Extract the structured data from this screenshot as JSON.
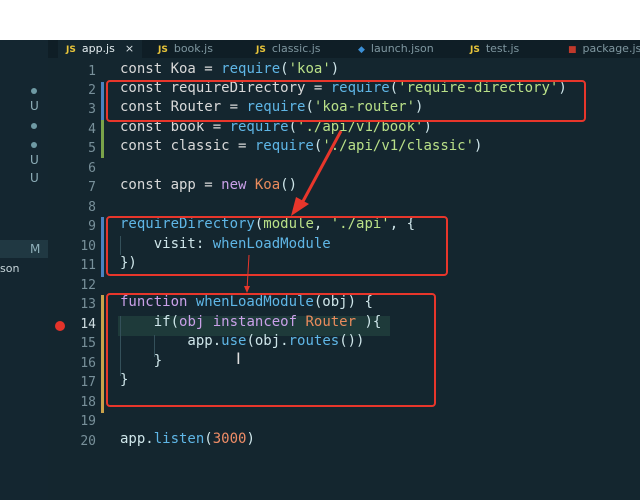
{
  "tabs": [
    {
      "icon": "JS",
      "label": "app.js",
      "active": true,
      "close": "×"
    },
    {
      "icon": "JS",
      "label": "book.js"
    },
    {
      "icon": "JS",
      "label": "classic.js"
    },
    {
      "icon": "vscode-icon",
      "label": "launch.json"
    },
    {
      "icon": "JS",
      "label": "test.js"
    },
    {
      "icon": "package-icon",
      "label": "package.js"
    }
  ],
  "sidebar": {
    "marks": [
      "U",
      "U",
      "U",
      "U",
      "M"
    ],
    "partial_item": "son"
  },
  "line_numbers": [
    "1",
    "2",
    "3",
    "4",
    "5",
    "6",
    "7",
    "8",
    "9",
    "10",
    "11",
    "12",
    "13",
    "14",
    "15",
    "16",
    "17",
    "18",
    "19",
    "20"
  ],
  "code": {
    "l1": {
      "a": "const Koa = ",
      "b": "require",
      "c": "(",
      "d": "'koa'",
      "e": ")"
    },
    "l2": {
      "a": "const requireDirectory = ",
      "b": "require",
      "c": "(",
      "d": "'require-directory'",
      "e": ")"
    },
    "l3": {
      "a": "const Router = ",
      "b": "require",
      "c": "(",
      "d": "'koa-router'",
      "e": ")"
    },
    "l4": {
      "a": "const book = ",
      "b": "require",
      "c": "(",
      "d": "'./api/v1/book'",
      "e": ")"
    },
    "l5": {
      "a": "const classic = ",
      "b": "require",
      "c": "(",
      "d": "'./api/v1/classic'",
      "e": ")"
    },
    "l7": {
      "a": "const app = ",
      "b": "new ",
      "c": "Koa",
      "d": "()"
    },
    "l9": {
      "a": "requireDirectory",
      "b": "(",
      "c": "module",
      "d": ", ",
      "e": "'./api'",
      "f": ", {"
    },
    "l10": {
      "a": "    visit: ",
      "b": "whenLoadModule"
    },
    "l11": {
      "a": "})"
    },
    "l13": {
      "a": "function ",
      "b": "whenLoadModule",
      "c": "(obj) {"
    },
    "l14": {
      "a": "    if(",
      "b": "obj",
      "c": " instanceof ",
      "d": "Router",
      "e": " ){"
    },
    "l15": {
      "a": "        app.",
      "b": "use",
      "c": "(obj.",
      "d": "routes",
      "e": "())"
    },
    "l16": {
      "a": "    }"
    },
    "l17": {
      "a": "}"
    },
    "l20": {
      "a": "app.",
      "b": "listen",
      "c": "(",
      "d": "3000",
      "e": ")"
    }
  },
  "colors": {
    "annotation_red": "#e8362b",
    "background": "#14262f",
    "string": "#b9e088",
    "function": "#5fb6e6",
    "keyword_var": "#c9a0e8",
    "class": "#e98b5c"
  }
}
